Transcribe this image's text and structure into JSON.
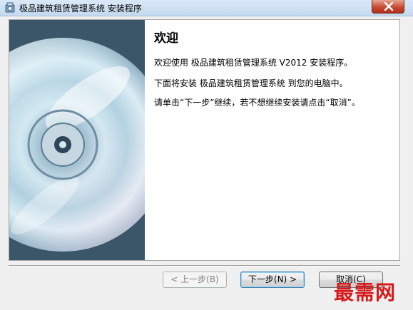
{
  "window": {
    "title": "极品建筑租赁管理系统 安装程序"
  },
  "content": {
    "heading": "欢迎",
    "paragraph1": "欢迎使用 极品建筑租赁管理系统 V2012 安装程序。",
    "paragraph2": "下面将安装 极品建筑租赁管理系统 到您的电脑中。",
    "paragraph3": "请单击“下一步”继续，若不想继续安装请点击“取消”。"
  },
  "buttons": {
    "back": "< 上一步(B)",
    "next": "下一步(N) >",
    "cancel": "取消(C)"
  },
  "watermark": "最需网",
  "icons": {
    "app": "installer-icon",
    "close": "close-icon",
    "banner": "cd-disc-image"
  }
}
